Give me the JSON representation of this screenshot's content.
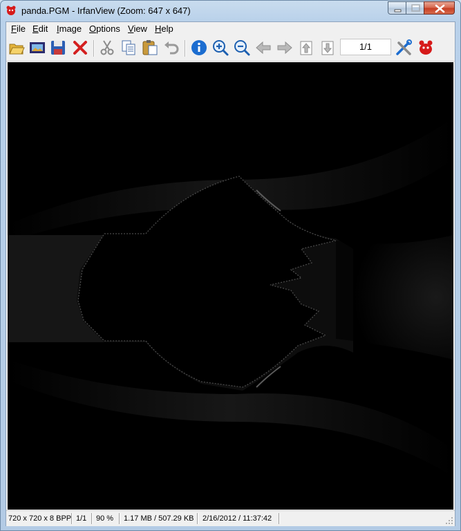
{
  "window": {
    "title": "panda.PGM - IrfanView (Zoom: 647 x 647)"
  },
  "menu": [
    {
      "pre": "",
      "u": "F",
      "post": "ile"
    },
    {
      "pre": "",
      "u": "E",
      "post": "dit"
    },
    {
      "pre": "",
      "u": "I",
      "post": "mage"
    },
    {
      "pre": "",
      "u": "O",
      "post": "ptions"
    },
    {
      "pre": "",
      "u": "V",
      "post": "iew"
    },
    {
      "pre": "",
      "u": "H",
      "post": "elp"
    }
  ],
  "toolbar": {
    "icons": [
      "open-folder-icon",
      "slideshow-icon",
      "save-icon",
      "delete-icon",
      "cut-icon",
      "copy-icon",
      "paste-icon",
      "undo-icon",
      "info-icon",
      "zoom-in-icon",
      "zoom-out-icon",
      "previous-icon",
      "next-icon",
      "first-page-icon",
      "last-page-icon",
      "settings-icon",
      "irfanview-icon"
    ],
    "page_indicator": "1/1"
  },
  "status": {
    "dimensions": "720 x 720 x 8 BPP",
    "page": "1/1",
    "zoom": "90 %",
    "size": "1.17 MB / 507.29 KB",
    "datetime": "2/16/2012 / 11:37:42"
  },
  "colors": {
    "accent": "#1c6dd0",
    "delete_red": "#d42020",
    "viewer_bg": "#000000"
  }
}
